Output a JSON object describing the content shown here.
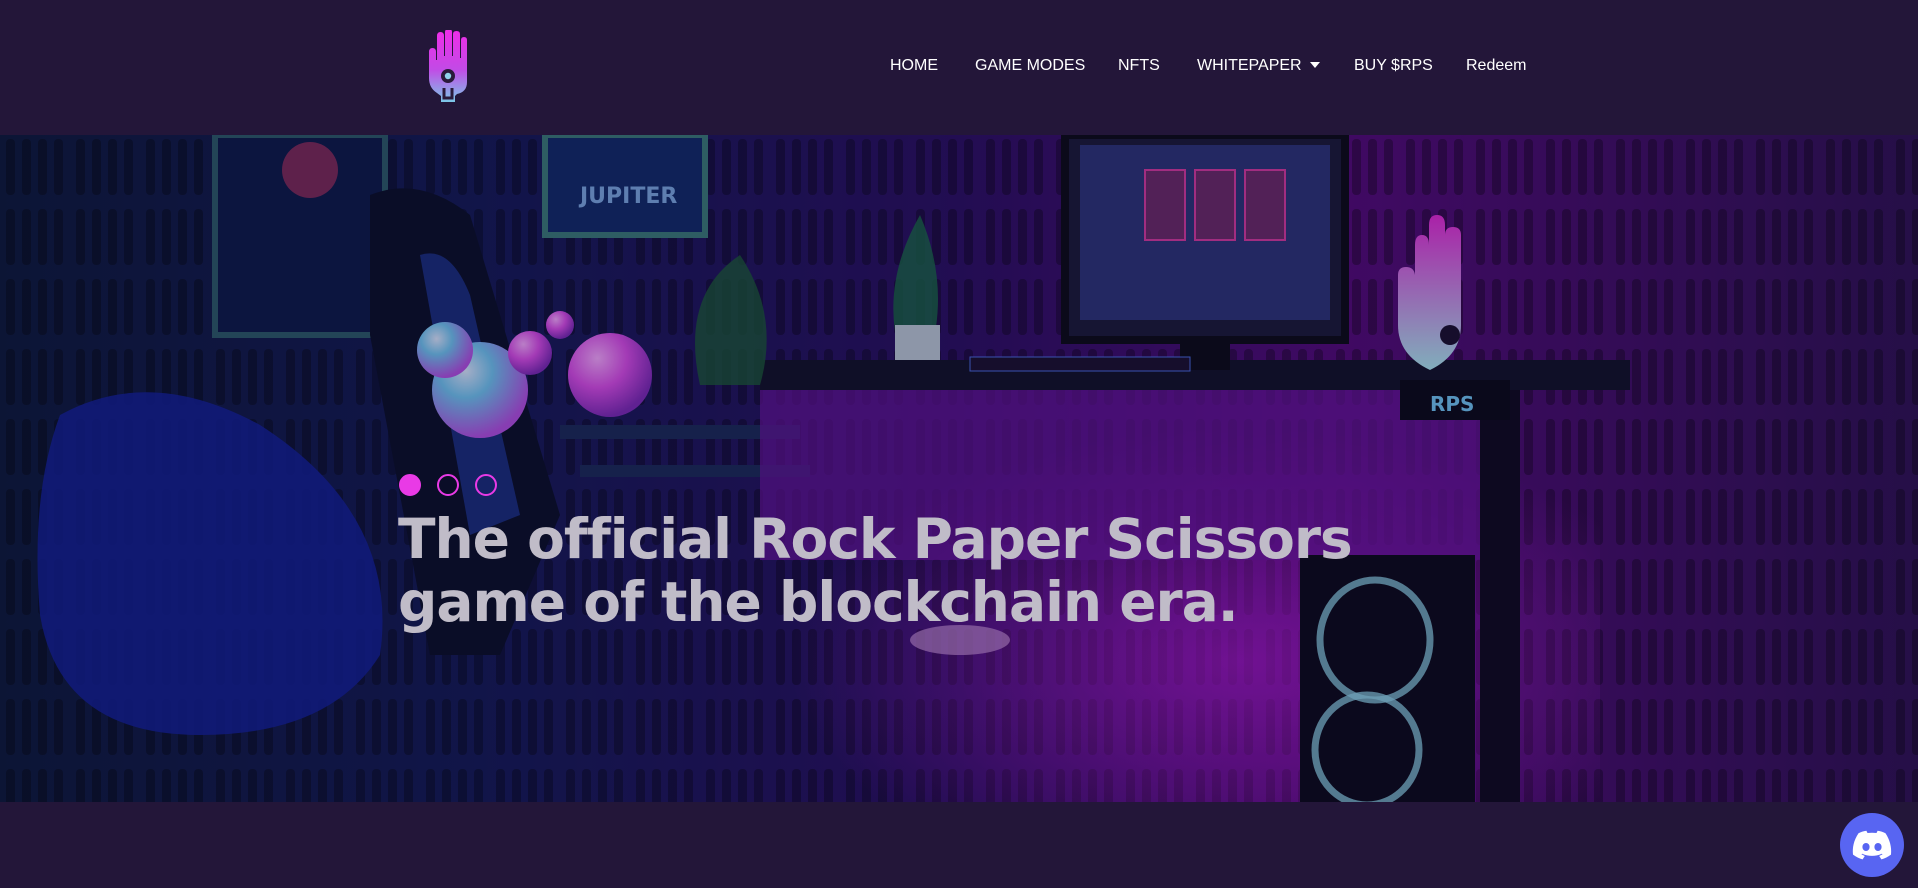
{
  "header": {
    "logo_icon": "hand-logo-icon",
    "nav": [
      {
        "label": "HOME"
      },
      {
        "label": "GAME MODES"
      },
      {
        "label": "NFTS"
      },
      {
        "label": "WHITEPAPER",
        "has_dropdown": true
      },
      {
        "label": "BUY $RPS"
      },
      {
        "label": "Redeem"
      }
    ]
  },
  "hero": {
    "headline_line1": "The official Rock Paper Scissors",
    "headline_line2": "game of the blockchain era.",
    "poster_text": "JUPITER",
    "trophy_text": "RPS",
    "slides": {
      "count": 3,
      "active": 1
    }
  },
  "floating": {
    "discord_icon": "discord-icon"
  },
  "colors": {
    "background": "#231639",
    "accent_pink": "#e93ae6",
    "headline": "#c0bcc8",
    "discord": "#5865f2"
  }
}
